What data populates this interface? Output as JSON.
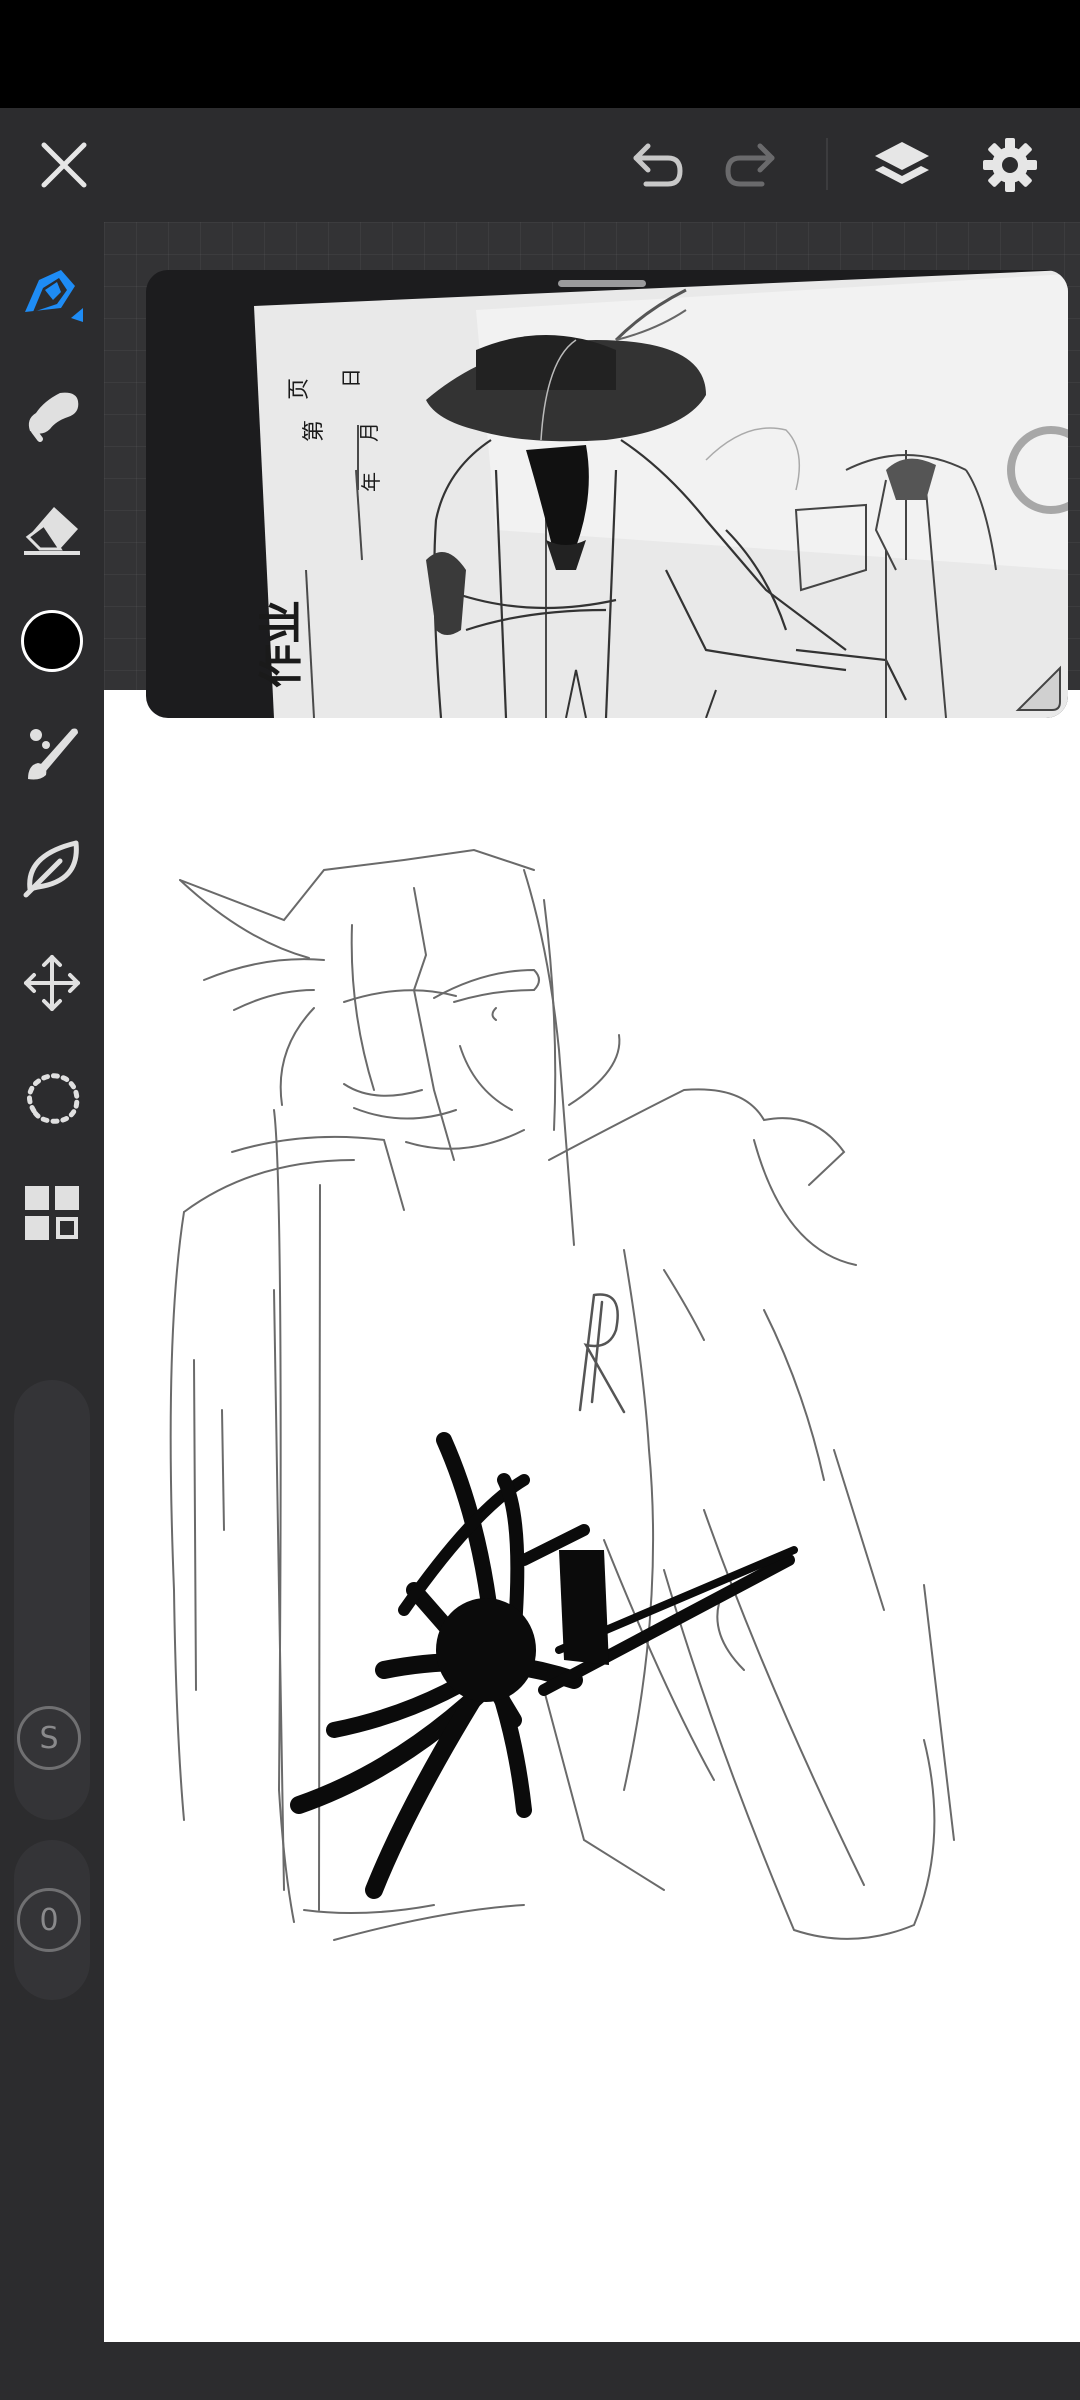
{
  "toolbar": {
    "close_icon": "close-icon",
    "undo_icon": "undo-icon",
    "redo_icon": "redo-icon",
    "layers_icon": "layers-icon",
    "settings_icon": "gear-icon"
  },
  "tools": [
    {
      "name": "pen-tool",
      "icon": "pen-icon",
      "active": true
    },
    {
      "name": "smudge-tool",
      "icon": "smudge-icon"
    },
    {
      "name": "eraser-tool",
      "icon": "eraser-icon"
    },
    {
      "name": "color-swatch",
      "color": "#000000"
    },
    {
      "name": "brush-tool",
      "icon": "brush-icon"
    },
    {
      "name": "fill-tool",
      "icon": "leaf-icon"
    },
    {
      "name": "transform-tool",
      "icon": "move-arrows-icon"
    },
    {
      "name": "lasso-tool",
      "icon": "lasso-icon"
    },
    {
      "name": "gallery-tool",
      "icon": "grid-icon"
    }
  ],
  "size_control": {
    "label": "S"
  },
  "opacity_control": {
    "label": "0"
  },
  "reference_photo": {
    "labels": [
      "作业",
      "第",
      "页",
      "年",
      "月",
      "日"
    ]
  },
  "colors": {
    "accent": "#1e8cf5",
    "panel": "#2c2c2e",
    "workspace": "#333335",
    "canvas": "#ffffff"
  }
}
